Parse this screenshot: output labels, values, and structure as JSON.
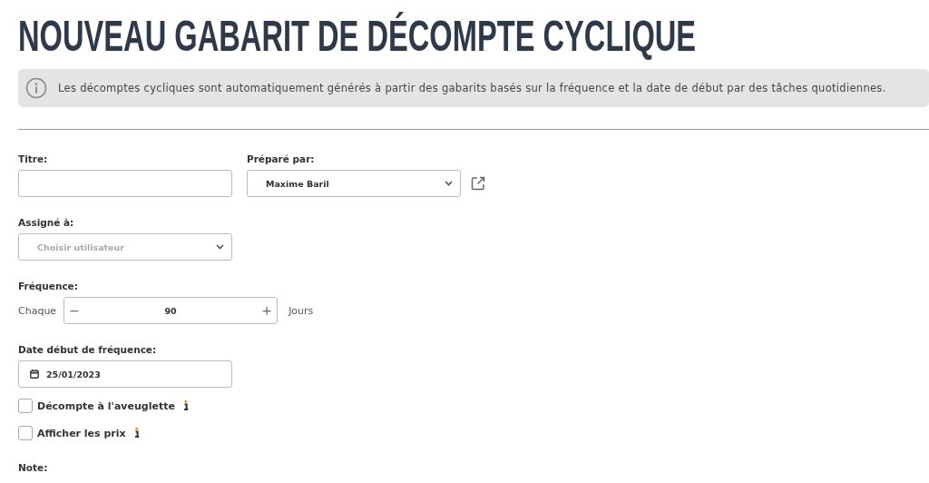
{
  "title": "NOUVEAU GABARIT DE DÉCOMPTE CYCLIQUE",
  "info": "Les décomptes cycliques sont automatiquement générés à partir des gabarits basés sur la fréquence et la date de début par des tâches quotidiennes.",
  "titre": {
    "label": "Titre:"
  },
  "prepare_par": {
    "label": "Préparé par:",
    "value": "Maxime Baril"
  },
  "assigne_a": {
    "label": "Assigné à:",
    "placeholder": "Choisir utilisateur"
  },
  "frequence": {
    "label": "Fréquence:",
    "prefix": "Chaque",
    "minus": "−",
    "value": "90",
    "plus": "+",
    "suffix": "Jours"
  },
  "date_debut": {
    "label": "Date début de fréquence:",
    "value": "25/01/2023"
  },
  "options": [
    {
      "label": "Décompte à l'aveuglette",
      "checked": false
    },
    {
      "label": "Afficher les prix",
      "checked": false
    }
  ],
  "note": {
    "label": "Note:"
  }
}
